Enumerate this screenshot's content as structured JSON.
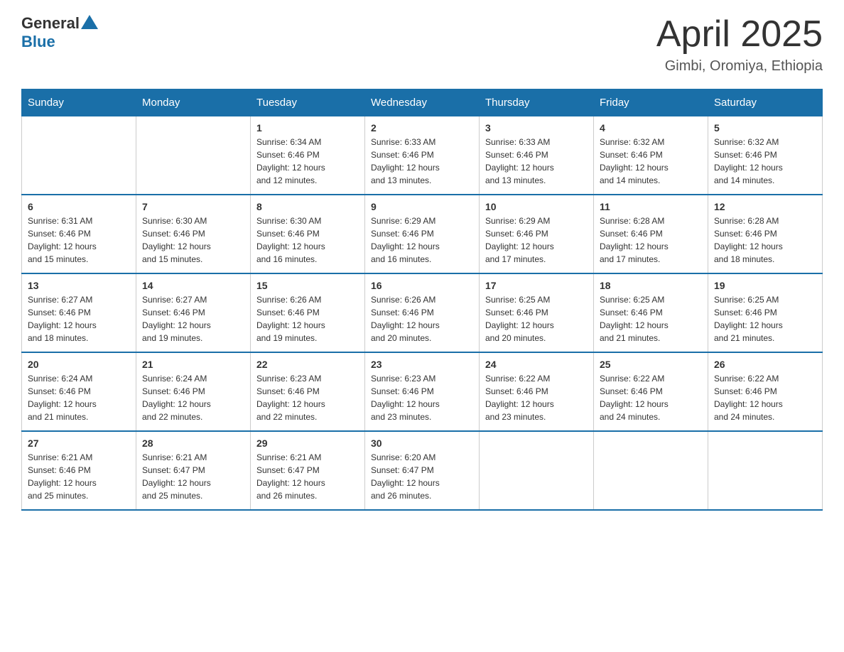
{
  "header": {
    "logo_general": "General",
    "logo_blue": "Blue",
    "month": "April 2025",
    "location": "Gimbi, Oromiya, Ethiopia"
  },
  "days_of_week": [
    "Sunday",
    "Monday",
    "Tuesday",
    "Wednesday",
    "Thursday",
    "Friday",
    "Saturday"
  ],
  "weeks": [
    [
      {
        "day": "",
        "info": ""
      },
      {
        "day": "",
        "info": ""
      },
      {
        "day": "1",
        "info": "Sunrise: 6:34 AM\nSunset: 6:46 PM\nDaylight: 12 hours\nand 12 minutes."
      },
      {
        "day": "2",
        "info": "Sunrise: 6:33 AM\nSunset: 6:46 PM\nDaylight: 12 hours\nand 13 minutes."
      },
      {
        "day": "3",
        "info": "Sunrise: 6:33 AM\nSunset: 6:46 PM\nDaylight: 12 hours\nand 13 minutes."
      },
      {
        "day": "4",
        "info": "Sunrise: 6:32 AM\nSunset: 6:46 PM\nDaylight: 12 hours\nand 14 minutes."
      },
      {
        "day": "5",
        "info": "Sunrise: 6:32 AM\nSunset: 6:46 PM\nDaylight: 12 hours\nand 14 minutes."
      }
    ],
    [
      {
        "day": "6",
        "info": "Sunrise: 6:31 AM\nSunset: 6:46 PM\nDaylight: 12 hours\nand 15 minutes."
      },
      {
        "day": "7",
        "info": "Sunrise: 6:30 AM\nSunset: 6:46 PM\nDaylight: 12 hours\nand 15 minutes."
      },
      {
        "day": "8",
        "info": "Sunrise: 6:30 AM\nSunset: 6:46 PM\nDaylight: 12 hours\nand 16 minutes."
      },
      {
        "day": "9",
        "info": "Sunrise: 6:29 AM\nSunset: 6:46 PM\nDaylight: 12 hours\nand 16 minutes."
      },
      {
        "day": "10",
        "info": "Sunrise: 6:29 AM\nSunset: 6:46 PM\nDaylight: 12 hours\nand 17 minutes."
      },
      {
        "day": "11",
        "info": "Sunrise: 6:28 AM\nSunset: 6:46 PM\nDaylight: 12 hours\nand 17 minutes."
      },
      {
        "day": "12",
        "info": "Sunrise: 6:28 AM\nSunset: 6:46 PM\nDaylight: 12 hours\nand 18 minutes."
      }
    ],
    [
      {
        "day": "13",
        "info": "Sunrise: 6:27 AM\nSunset: 6:46 PM\nDaylight: 12 hours\nand 18 minutes."
      },
      {
        "day": "14",
        "info": "Sunrise: 6:27 AM\nSunset: 6:46 PM\nDaylight: 12 hours\nand 19 minutes."
      },
      {
        "day": "15",
        "info": "Sunrise: 6:26 AM\nSunset: 6:46 PM\nDaylight: 12 hours\nand 19 minutes."
      },
      {
        "day": "16",
        "info": "Sunrise: 6:26 AM\nSunset: 6:46 PM\nDaylight: 12 hours\nand 20 minutes."
      },
      {
        "day": "17",
        "info": "Sunrise: 6:25 AM\nSunset: 6:46 PM\nDaylight: 12 hours\nand 20 minutes."
      },
      {
        "day": "18",
        "info": "Sunrise: 6:25 AM\nSunset: 6:46 PM\nDaylight: 12 hours\nand 21 minutes."
      },
      {
        "day": "19",
        "info": "Sunrise: 6:25 AM\nSunset: 6:46 PM\nDaylight: 12 hours\nand 21 minutes."
      }
    ],
    [
      {
        "day": "20",
        "info": "Sunrise: 6:24 AM\nSunset: 6:46 PM\nDaylight: 12 hours\nand 21 minutes."
      },
      {
        "day": "21",
        "info": "Sunrise: 6:24 AM\nSunset: 6:46 PM\nDaylight: 12 hours\nand 22 minutes."
      },
      {
        "day": "22",
        "info": "Sunrise: 6:23 AM\nSunset: 6:46 PM\nDaylight: 12 hours\nand 22 minutes."
      },
      {
        "day": "23",
        "info": "Sunrise: 6:23 AM\nSunset: 6:46 PM\nDaylight: 12 hours\nand 23 minutes."
      },
      {
        "day": "24",
        "info": "Sunrise: 6:22 AM\nSunset: 6:46 PM\nDaylight: 12 hours\nand 23 minutes."
      },
      {
        "day": "25",
        "info": "Sunrise: 6:22 AM\nSunset: 6:46 PM\nDaylight: 12 hours\nand 24 minutes."
      },
      {
        "day": "26",
        "info": "Sunrise: 6:22 AM\nSunset: 6:46 PM\nDaylight: 12 hours\nand 24 minutes."
      }
    ],
    [
      {
        "day": "27",
        "info": "Sunrise: 6:21 AM\nSunset: 6:46 PM\nDaylight: 12 hours\nand 25 minutes."
      },
      {
        "day": "28",
        "info": "Sunrise: 6:21 AM\nSunset: 6:47 PM\nDaylight: 12 hours\nand 25 minutes."
      },
      {
        "day": "29",
        "info": "Sunrise: 6:21 AM\nSunset: 6:47 PM\nDaylight: 12 hours\nand 26 minutes."
      },
      {
        "day": "30",
        "info": "Sunrise: 6:20 AM\nSunset: 6:47 PM\nDaylight: 12 hours\nand 26 minutes."
      },
      {
        "day": "",
        "info": ""
      },
      {
        "day": "",
        "info": ""
      },
      {
        "day": "",
        "info": ""
      }
    ]
  ],
  "colors": {
    "header_bg": "#1a6fa8",
    "header_text": "#ffffff",
    "border": "#cccccc",
    "row_border": "#1a6fa8"
  }
}
